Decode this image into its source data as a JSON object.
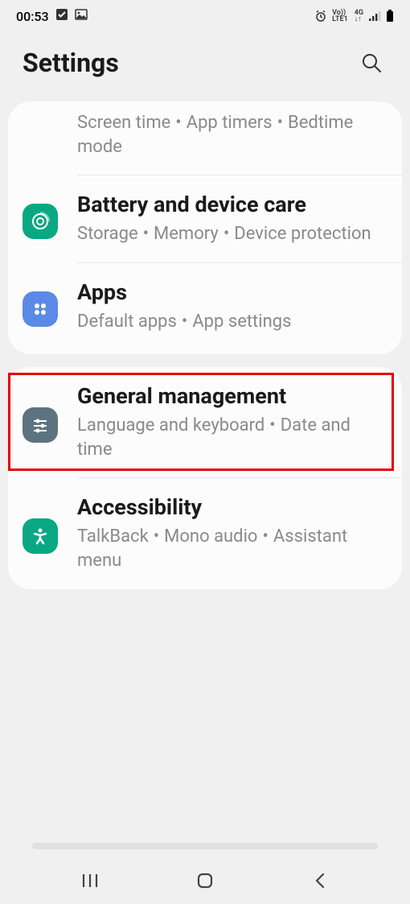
{
  "status": {
    "time": "00:53",
    "vo": "Vo))",
    "lte": "LTE1",
    "net": "4G"
  },
  "header": {
    "title": "Settings"
  },
  "cards": [
    {
      "items": [
        {
          "subtitle_parts": [
            "Screen time",
            "App timers",
            "Bedtime mode"
          ]
        },
        {
          "title": "Battery and device care",
          "subtitle_parts": [
            "Storage",
            "Memory",
            "Device protection"
          ],
          "icon_color": "#0aa882"
        },
        {
          "title": "Apps",
          "subtitle_parts": [
            "Default apps",
            "App settings"
          ],
          "icon_color": "#5b8ae6",
          "highlighted": true
        }
      ]
    },
    {
      "items": [
        {
          "title": "General management",
          "subtitle_parts": [
            "Language and keyboard",
            "Date and time"
          ],
          "icon_color": "#5e7380"
        },
        {
          "title": "Accessibility",
          "subtitle_parts": [
            "TalkBack",
            "Mono audio",
            "Assistant menu"
          ],
          "icon_color": "#0aa882"
        }
      ]
    }
  ]
}
